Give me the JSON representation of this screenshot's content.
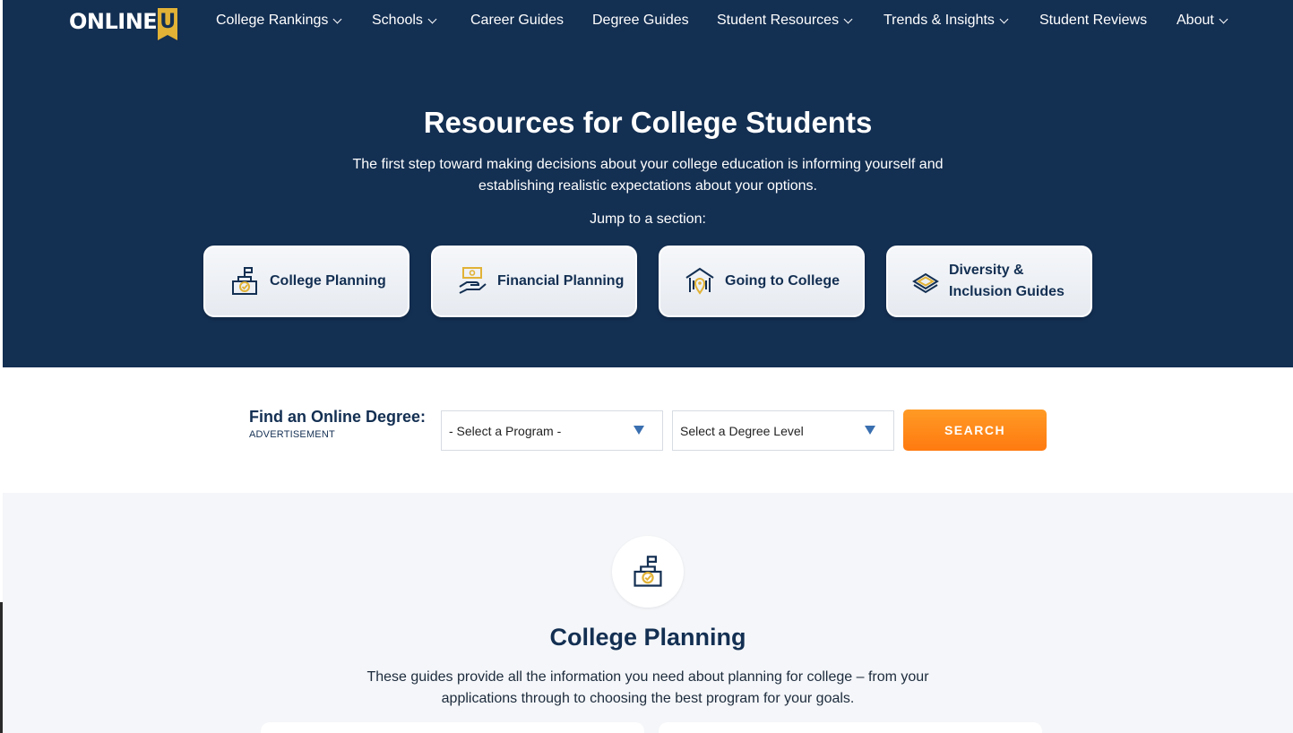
{
  "logo": {
    "text": "ONLINE",
    "u": "U"
  },
  "nav": {
    "items": [
      {
        "label": "College Rankings",
        "dropdown": true
      },
      {
        "label": "Schools",
        "dropdown": true
      },
      {
        "label": "Career Guides",
        "dropdown": false
      },
      {
        "label": "Degree Guides",
        "dropdown": false
      },
      {
        "label": "Student Resources",
        "dropdown": true
      },
      {
        "label": "Trends & Insights",
        "dropdown": true
      },
      {
        "label": "Student Reviews",
        "dropdown": false
      },
      {
        "label": "About",
        "dropdown": true
      }
    ]
  },
  "hero": {
    "title": "Resources for College Students",
    "subtitle": "The first step toward making decisions about your college education is informing yourself and establishing realistic expectations about your options.",
    "jump_label": "Jump to a section:",
    "cards": [
      {
        "label": "College Planning",
        "icon": "school-icon"
      },
      {
        "label": "Financial Planning",
        "icon": "money-hand-icon"
      },
      {
        "label": "Going to College",
        "icon": "campus-pin-icon"
      },
      {
        "label_line1": "Diversity &",
        "label_line2": "Inclusion Guides",
        "icon": "layers-icon"
      }
    ]
  },
  "finder": {
    "title": "Find an Online Degree:",
    "ad_label": "ADVERTISEMENT",
    "program_select": "- Select a Program -",
    "level_select": "Select a Degree Level",
    "search_label": "SEARCH"
  },
  "planning": {
    "title": "College Planning",
    "description": "These guides provide all the information you need about planning for college – from your applications through to choosing the best program for your goals."
  },
  "colors": {
    "navy": "#132f52",
    "gold": "#e1b236",
    "orange": "#ff8a1a",
    "section_bg": "#f4f6f9"
  }
}
